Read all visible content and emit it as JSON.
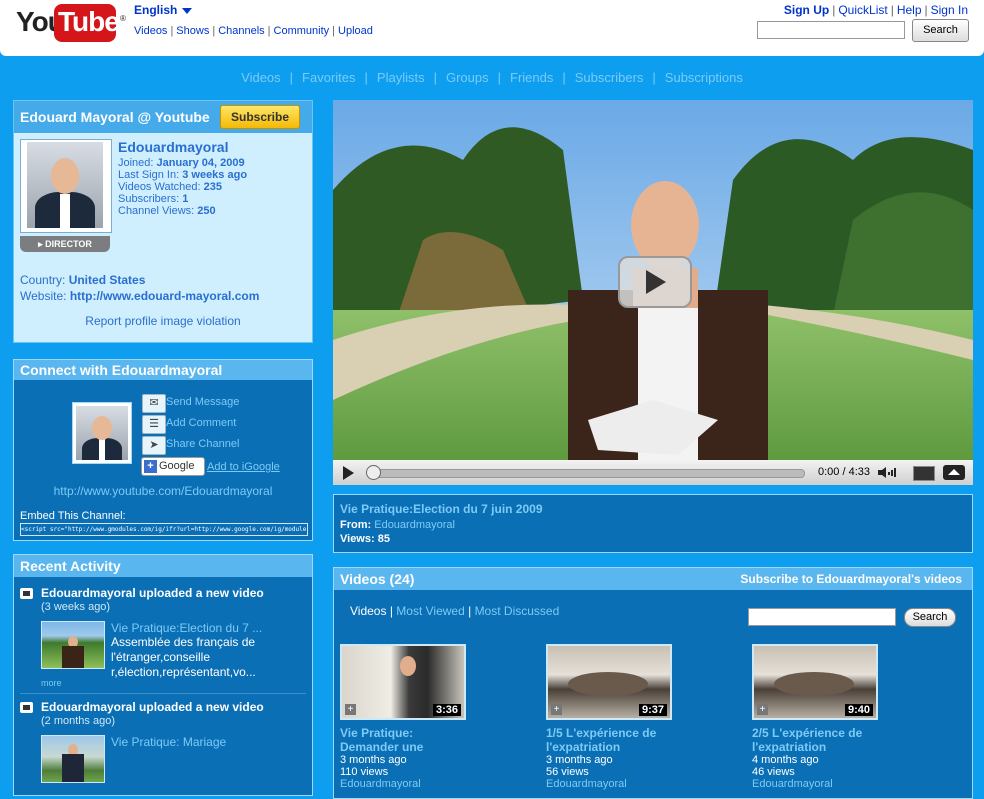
{
  "header": {
    "logo_you": "You",
    "logo_tube": "Tube",
    "logo_tm": "®",
    "language": "English",
    "nav": [
      "Videos",
      "Shows",
      "Channels",
      "Community",
      "Upload"
    ],
    "account_links": [
      "Sign Up",
      "QuickList",
      "Help",
      "Sign In"
    ],
    "search_button": "Search"
  },
  "channel_nav": [
    "Videos",
    "Favorites",
    "Playlists",
    "Groups",
    "Friends",
    "Subscribers",
    "Subscriptions"
  ],
  "profile": {
    "title": "Edouard Mayoral @ Youtube",
    "subscribe": "Subscribe",
    "badge": "DIRECTOR",
    "username": "Edouardmayoral",
    "joined_label": "Joined: ",
    "joined": "January 04, 2009",
    "last_signin_label": "Last Sign In: ",
    "last_signin": "3 weeks ago",
    "videos_watched_label": "Videos Watched: ",
    "videos_watched": "235",
    "subscribers_label": "Subscribers: ",
    "subscribers": "1",
    "channel_views_label": "Channel Views: ",
    "channel_views": "250",
    "country_label": "Country: ",
    "country": "United States",
    "website_label": "Website: ",
    "website": "http://www.edouard-mayoral.com",
    "report": "Report profile image violation"
  },
  "connect": {
    "title": "Connect with Edouardmayoral",
    "send_message": "Send Message",
    "add_comment": "Add Comment",
    "share_channel": "Share Channel",
    "google": "Google",
    "add_igoogle": "Add to iGoogle",
    "channel_url": "http://www.youtube.com/Edouardmayoral",
    "embed_label": "Embed This Channel:",
    "embed_code": "<script src=\"http://www.gmodules.com/ig/ifr?url=http://www.google.com/ig/modules"
  },
  "activity": {
    "title": "Recent Activity",
    "items": [
      {
        "title": "Edouardmayoral uploaded a new video",
        "time": "(3 weeks ago)",
        "video_title": "Vie Pratique:Election du 7 ...",
        "desc": "Assemblée des français de l'étranger,conseille r,élection,représentant,vo...",
        "more": "more"
      },
      {
        "title": "Edouardmayoral uploaded a new video",
        "time": "(2 months ago)",
        "video_title": "Vie Pratique: Mariage"
      }
    ]
  },
  "player": {
    "time": "0:00 / 4:33",
    "progress": 0.0
  },
  "video_info": {
    "title": "Vie Pratique:Election du 7 juin 2009",
    "from_label": "From: ",
    "from": "Edouardmayoral",
    "views": "Views: 85"
  },
  "videos": {
    "title": "Videos (24)",
    "subscribe_link": "Subscribe to Edouardmayoral's videos",
    "tabs": [
      "Videos",
      "Most Viewed",
      "Most Discussed"
    ],
    "search_button": "Search",
    "items": [
      {
        "duration": "3:36",
        "title": "Vie Pratique: Demander une",
        "age": "3 months ago",
        "views": "110 views",
        "author": "Edouardmayoral"
      },
      {
        "duration": "9:37",
        "title": "1/5 L'expérience de l'expatriation",
        "age": "3 months ago",
        "views": "56 views",
        "author": "Edouardmayoral"
      },
      {
        "duration": "9:40",
        "title": "2/5 L'expérience de l'expatriation",
        "age": "4 months ago",
        "views": "46 views",
        "author": "Edouardmayoral"
      }
    ]
  },
  "colors": {
    "page_bg": "#0d9ef0",
    "panel_bg": "#0b6fb6",
    "link_light": "#7ccbf5",
    "subscribe_yellow": "#f5b905"
  }
}
